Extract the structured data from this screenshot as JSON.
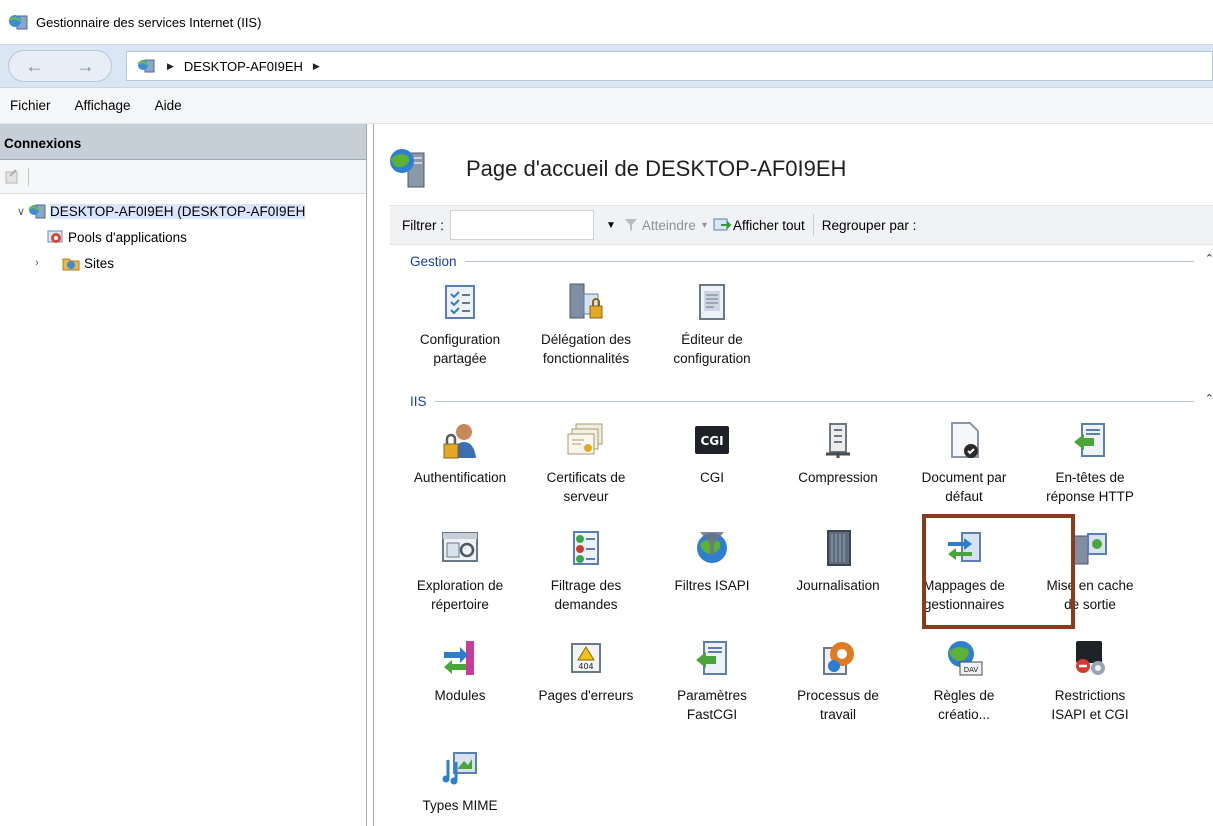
{
  "window": {
    "title": "Gestionnaire des services Internet (IIS)"
  },
  "address": {
    "crumb": "DESKTOP-AF0I9EH"
  },
  "menu": {
    "items": [
      "Fichier",
      "Affichage",
      "Aide"
    ]
  },
  "connections": {
    "header": "Connexions",
    "tree": {
      "server": "DESKTOP-AF0I9EH (DESKTOP-AF0I9EH",
      "app_pools": "Pools d'applications",
      "sites": "Sites"
    }
  },
  "main": {
    "title": "Page d'accueil de DESKTOP-AF0I9EH",
    "filter": {
      "label": "Filtrer :",
      "value": "",
      "go": "Atteindre",
      "show_all": "Afficher tout",
      "group_by": "Regrouper par :"
    },
    "groups": {
      "gestion": {
        "label": "Gestion",
        "items": [
          "Configuration\npartagée",
          "Délégation des\nfonctionnalités",
          "Éditeur de\nconfiguration"
        ]
      },
      "iis": {
        "label": "IIS",
        "items": [
          "Authentification",
          "Certificats de\nserveur",
          "CGI",
          "Compression",
          "Document par\ndéfaut",
          "En-têtes de\nréponse HTTP",
          "Exploration de\nrépertoire",
          "Filtrage des\ndemandes",
          "Filtres ISAPI",
          "Journalisation",
          "Mappages de\ngestionnaires",
          "Mise en cache\nde sortie",
          "Modules",
          "Pages d'erreurs",
          "Paramètres\nFastCGI",
          "Processus de\ntravail",
          "Règles de\ncréatio...",
          "Restrictions\nISAPI et CGI",
          "Types MIME"
        ]
      }
    },
    "icon_texts": {
      "cgi": "CGI",
      "error": "404",
      "dav": "DAV"
    }
  },
  "colors": {
    "highlight": "#8a3b1c",
    "group_header": "#1a3fa0",
    "address_bg": "#dbe6f4"
  }
}
